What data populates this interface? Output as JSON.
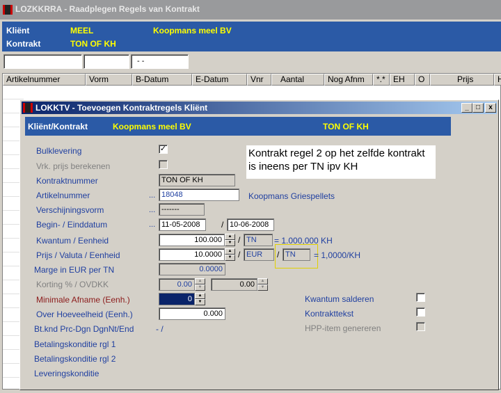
{
  "back_window": {
    "title": "LOZKKRRA - Raadplegen Regels van Kontrakt",
    "client_label": "Kliënt",
    "client_code": "MEEL",
    "client_name": "Koopmans meel BV",
    "contract_label": "Kontrakt",
    "contract_value": "TON OF KH",
    "filter_fields": [
      "",
      "",
      "- -"
    ],
    "columns": [
      "Artikelnummer",
      "Vorm",
      "B-Datum",
      "E-Datum",
      "Vnr",
      "Aantal",
      "Nog Afnm",
      "*.*",
      "EH",
      "O",
      "Prijs",
      "H"
    ]
  },
  "dialog": {
    "title": "LOKKTV - Toevoegen Kontraktregels Kliënt",
    "title_buttons": [
      "_",
      "□",
      "x"
    ],
    "header_label": "Kliënt/Kontrakt",
    "header_client": "Koopmans meel BV",
    "header_contract": "TON OF KH",
    "note": "Kontrakt regel 2 op het zelfde kontrakt is ineens per TN ipv KH",
    "fields": {
      "bulk_label": "Bulklevering",
      "bulk_checked": true,
      "vrk_label": "Vrk. prijs berekenen",
      "vrk_checked": false,
      "kontraktnummer_label": "Kontraktnummer",
      "kontraktnummer_value": "TON OF KH",
      "artikelnummer_label": "Artikelnummer",
      "artikelnummer_value": "18048",
      "artikel_desc": "Koopmans Griespellets",
      "verschijning_label": "Verschijningsvorm",
      "verschijning_value": "-------",
      "datum_label": "Begin- / Einddatum",
      "begin_datum": "11-05-2008",
      "eind_datum": "10-06-2008",
      "kwantum_label": "Kwantum / Eenheid",
      "kwantum_value": "100.000",
      "kwantum_unit": "TN",
      "kwantum_result": "= 1.000,000 KH",
      "prijs_label": "Prijs / Valuta / Eenheid",
      "prijs_value": "10.0000",
      "valuta": "EUR",
      "prijs_unit": "TN",
      "prijs_result": "= 1,0000/KH",
      "marge_label": "Marge in EUR per TN",
      "marge_value": "0.0000",
      "korting_label": "Korting % / OVDKK",
      "korting_value1": "0.00",
      "korting_value2": "0.00",
      "min_afname_label": "Minimale Afname (Eenh.)",
      "min_afname_value": "0",
      "over_label": "Over Hoeveelheid (Eenh.)",
      "over_value": "0.000",
      "btkd_label": "Bt.knd Prc-Dgn DgnNt/End",
      "btkd_value": "- /",
      "betaling1_label": "Betalingskonditie rgl 1",
      "betaling2_label": "Betalingskonditie rgl 2",
      "levering_label": "Leveringskonditie",
      "separator_slash": "/",
      "dots": "...",
      "kwantum_salderen_label": "Kwantum salderen",
      "kontrakttekst_label": "Kontrakttekst",
      "hpp_label": "HPP-item genereren"
    }
  }
}
